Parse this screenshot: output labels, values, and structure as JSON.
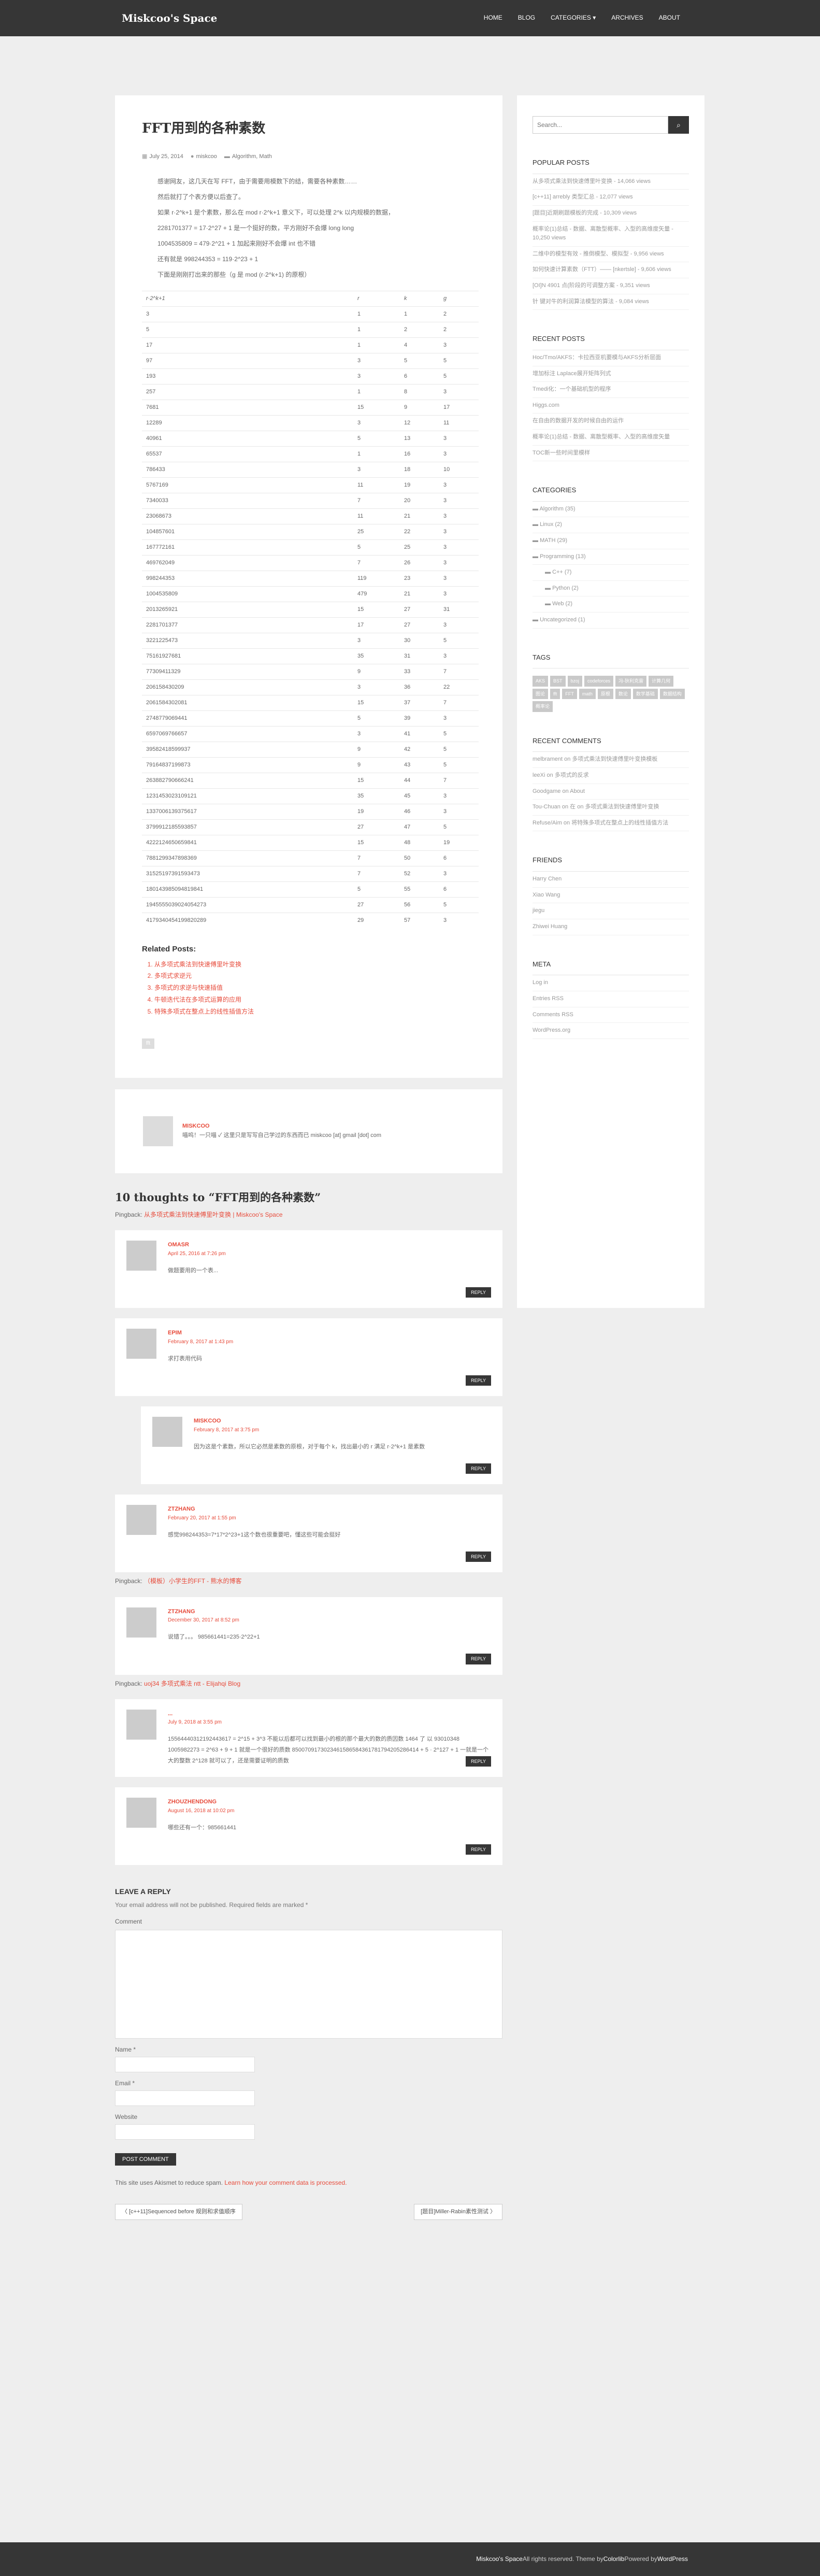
{
  "nav": {
    "brand": "Miskcoo's Space",
    "items": [
      "HOME",
      "BLOG",
      "CATEGORIES ▾",
      "ARCHIVES",
      "ABOUT"
    ]
  },
  "post": {
    "title": "FFT用到的各种素数",
    "date": "July 25, 2014",
    "author": "miskcoo",
    "category": "Algorithm, Math",
    "paras": [
      "感谢网友，这几天在写 FFT，由于需要用模数下的结，需要各种素数……",
      "然后就打了个表方便以后查了。",
      "如果 r·2^k+1 是个素数，那么在 mod r·2^k+1 意义下，可以处理 2^k 以内规模的数据，",
      "2281701377 = 17·2^27 + 1 是一个挺好的数，平方刚好不会爆 long long",
      "1004535809 = 479·2^21 + 1 加起来刚好不会爆 int 也不错",
      "还有就是 998244353 = 119·2^23 + 1",
      "下面是刚刚打出来的那些（g 是 mod (r·2^k+1) 的原根）"
    ],
    "table_headers": [
      "r·2^k+1",
      "r",
      "k",
      "g"
    ],
    "rows": [
      [
        "3",
        "1",
        "1",
        "2"
      ],
      [
        "5",
        "1",
        "2",
        "2"
      ],
      [
        "17",
        "1",
        "4",
        "3"
      ],
      [
        "97",
        "3",
        "5",
        "5"
      ],
      [
        "193",
        "3",
        "6",
        "5"
      ],
      [
        "257",
        "1",
        "8",
        "3"
      ],
      [
        "7681",
        "15",
        "9",
        "17"
      ],
      [
        "12289",
        "3",
        "12",
        "11"
      ],
      [
        "40961",
        "5",
        "13",
        "3"
      ],
      [
        "65537",
        "1",
        "16",
        "3"
      ],
      [
        "786433",
        "3",
        "18",
        "10"
      ],
      [
        "5767169",
        "11",
        "19",
        "3"
      ],
      [
        "7340033",
        "7",
        "20",
        "3"
      ],
      [
        "23068673",
        "11",
        "21",
        "3"
      ],
      [
        "104857601",
        "25",
        "22",
        "3"
      ],
      [
        "167772161",
        "5",
        "25",
        "3"
      ],
      [
        "469762049",
        "7",
        "26",
        "3"
      ],
      [
        "998244353",
        "119",
        "23",
        "3"
      ],
      [
        "1004535809",
        "479",
        "21",
        "3"
      ],
      [
        "2013265921",
        "15",
        "27",
        "31"
      ],
      [
        "2281701377",
        "17",
        "27",
        "3"
      ],
      [
        "3221225473",
        "3",
        "30",
        "5"
      ],
      [
        "75161927681",
        "35",
        "31",
        "3"
      ],
      [
        "77309411329",
        "9",
        "33",
        "7"
      ],
      [
        "206158430209",
        "3",
        "36",
        "22"
      ],
      [
        "2061584302081",
        "15",
        "37",
        "7"
      ],
      [
        "2748779069441",
        "5",
        "39",
        "3"
      ],
      [
        "6597069766657",
        "3",
        "41",
        "5"
      ],
      [
        "39582418599937",
        "9",
        "42",
        "5"
      ],
      [
        "79164837199873",
        "9",
        "43",
        "5"
      ],
      [
        "263882790666241",
        "15",
        "44",
        "7"
      ],
      [
        "1231453023109121",
        "35",
        "45",
        "3"
      ],
      [
        "1337006139375617",
        "19",
        "46",
        "3"
      ],
      [
        "3799912185593857",
        "27",
        "47",
        "5"
      ],
      [
        "4222124650659841",
        "15",
        "48",
        "19"
      ],
      [
        "7881299347898369",
        "7",
        "50",
        "6"
      ],
      [
        "31525197391593473",
        "7",
        "52",
        "3"
      ],
      [
        "180143985094819841",
        "5",
        "55",
        "6"
      ],
      [
        "1945555039024054273",
        "27",
        "56",
        "5"
      ],
      [
        "4179340454199820289",
        "29",
        "57",
        "3"
      ]
    ],
    "related_title": "Related Posts:",
    "related": [
      "从多项式乘法到快速傅里叶变换",
      "多项式求逆元",
      "多项式的求逆与快速插值",
      "牛顿迭代法在多项式运算的应用",
      "特殊多项式在整点上的线性插值方法"
    ],
    "tag": "fft",
    "author_box_name": "MISKCOO",
    "author_box_desc": "喵呜！一只喵 ✓  这里只是写写自己学过的东西而已  miskcoo [at] gmail [dot] com"
  },
  "comments": {
    "title": "10 thoughts to “FFT用到的各种素数”",
    "pingback1_prefix": "Pingback: ",
    "pingback1_link": "从多项式乘法到快速傅里叶变换 | Miskcoo's Space",
    "items": [
      {
        "name": "OMASR",
        "date": "April 25, 2016 at 7:26 pm",
        "text": "做题要用的一个表..."
      },
      {
        "name": "EPIM",
        "date": "February 8, 2017 at 1:43 pm",
        "text": "求打表用代码"
      },
      {
        "name": "MISKCOO",
        "date": "February 8, 2017 at 3:75 pm",
        "text": "因为这是个素数，所以它必然是素数的原根，对于每个 k，找出最小的 r 满足 r·2^k+1 是素数"
      },
      {
        "name": "ZTZHANG",
        "date": "February 20, 2017 at 1:55 pm",
        "text": "感觉998244353=7*17*2^23+1这个数也很重要吧，懂这些可能会挺好"
      },
      {
        "name": "ZTZHANG",
        "date": "December 30, 2017 at 8:52 pm",
        "text": "说错了。。。 985661441=235·2^22+1"
      },
      {
        "name": "...",
        "date": "July 9, 2018 at 3:55 pm",
        "text": "15564440312192443617 = 2^15 + 3^3 不能以后都可以找到最小的根的那个最大的数的质因数 1464 了 以 93010348 1005982273 = 2^63 + 9 + 1 就是一个很好的质数 8500709173023461586584361781794205286414 + 5 · 2^127 + 1 一就是一个大的整数 2^128 就可以了，还是需要证明的质数"
      },
      {
        "name": "ZHOUZHENDONG",
        "date": "August 16, 2018 at 10:02 pm",
        "text": "哪些还有一个：985661441"
      }
    ],
    "pingback2_link": "（模板）小学生的FFT - 熊水的博客",
    "pingback3_link": "uoj34 多项式乘法 ntt - Elijahqi Blog"
  },
  "form": {
    "title": "LEAVE A REPLY",
    "note": "Your email address will not be published. Required fields are marked *",
    "comment_label": "Comment",
    "name_label": "Name *",
    "email_label": "Email *",
    "website_label": "Website",
    "submit": "POST COMMENT",
    "spam_prefix": "This site uses Akismet to reduce spam. ",
    "spam_link": "Learn how your comment data is processed.",
    "prev": "〈 [c++11]Sequenced before 规则和求值顺序",
    "next": "[题目]Miller-Rabin素性测试 〉"
  },
  "sidebar": {
    "search_placeholder": "Search...",
    "popular_title": "POPULAR POSTS",
    "popular": [
      "从多项式乘法到快速傅里叶变换 - 14,066 views",
      "[c++11] arrebly 类型汇总 - 12,077 views",
      "[题目]近期刷题模板的完成 - 10,309 views",
      "概率论(1)总结 - 数据、离散型概率、入型的高维度矢量 - 10,250 views",
      "二维中的模型有效 - 推倒模型、模拟型 - 9,956 views",
      "如何快速计算素数（FTT）—— [nkertsle] - 9,606 views",
      "[OI]N 4901 点(阶段的可调整方案 - 9,351 views",
      "针 键对牛的利润算法模型的算法 - 9,084 views"
    ],
    "recent_title": "RECENT POSTS",
    "recent": [
      "Hoc/Tmo/AKFS：卡拉西亚机要模与AKFS分析层面",
      "增加标注 Laplace展开矩阵列式",
      "Tmedi化：一个基础机型的程序",
      "Higgs.com",
      "在自由的数据开发的时候自由的运作",
      "概率论(1)总结 - 数据、离散型概率、入型的高维度矢量",
      "TOC新一些时间里模样"
    ],
    "categories_title": "CATEGORIES",
    "categories": [
      {
        "label": "Algorithm (35)",
        "sub": false
      },
      {
        "label": "Linux (2)",
        "sub": false
      },
      {
        "label": "MATH (29)",
        "sub": false
      },
      {
        "label": "Programming (13)",
        "sub": false
      },
      {
        "label": "C++ (7)",
        "sub": true
      },
      {
        "label": "Python (2)",
        "sub": true
      },
      {
        "label": "Web (2)",
        "sub": true
      },
      {
        "label": "Uncategorized (1)",
        "sub": false
      }
    ],
    "tags_title": "TAGS",
    "tags": [
      "AKS",
      "BST",
      "bzoj",
      "codeforces",
      "冯-狄利克雷",
      "计算几何",
      "图论",
      "fft",
      "FFT",
      "math",
      "原根",
      "数论",
      "数学基础",
      "数据结构",
      "概率论"
    ],
    "comments_title": "RECENT COMMENTS",
    "comments": [
      "melbrament on 多项式乘法到快速傅里叶变换模板",
      "leeXi on 多项式的反求",
      "Goodgame on About",
      "Tou-Chuan on 在 on 多项式乘法到快速傅里叶变换",
      "Refuse/Aim on 将特殊多项式在整点上的线性插值方法"
    ],
    "friends_title": "FRIENDS",
    "friends": [
      "Harry Chen",
      "Xiao Wang",
      "jiegu",
      "Zhiwei Huang"
    ],
    "meta_title": "META",
    "meta": [
      "Log in",
      "Entries RSS",
      "Comments RSS",
      "WordPress.org"
    ]
  },
  "footer": {
    "prefix": "Miskcoo's Space",
    "rest": " All rights reserved. Theme by ",
    "theme": "Colorlib",
    "powered": " Powered by ",
    "wp": "WordPress"
  }
}
